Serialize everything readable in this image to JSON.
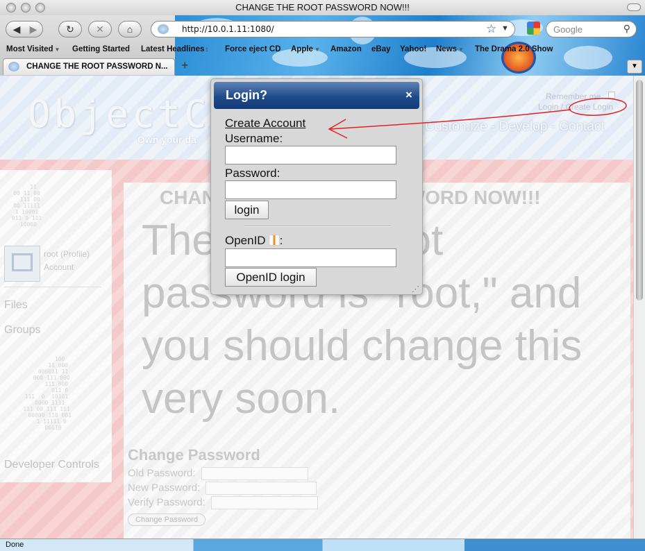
{
  "window": {
    "title": "CHANGE THE ROOT PASSWORD NOW!!!"
  },
  "toolbar": {
    "url": "http://10.0.1.11:1080/",
    "search_placeholder": "Google",
    "back_icon": "back-arrow-icon",
    "forward_icon": "forward-arrow-icon",
    "reload_icon": "reload-icon",
    "stop_icon": "stop-icon",
    "home_icon": "home-icon"
  },
  "bookmarks": [
    {
      "label": "Most Visited",
      "dropdown": true
    },
    {
      "label": "Getting Started",
      "dropdown": false
    },
    {
      "label": "Latest Headlines",
      "dropdown": false
    },
    {
      "label": "Force eject CD",
      "dropdown": false
    },
    {
      "label": "Apple",
      "dropdown": true
    },
    {
      "label": "Amazon",
      "dropdown": false
    },
    {
      "label": "eBay",
      "dropdown": false
    },
    {
      "label": "Yahoo!",
      "dropdown": false
    },
    {
      "label": "News",
      "dropdown": true
    },
    {
      "label": "The Drama 2.0 Show",
      "dropdown": false
    }
  ],
  "tabs": [
    {
      "label": "CHANGE THE ROOT PASSWORD N..."
    }
  ],
  "site": {
    "logo": "ObjectC",
    "tagline": "Own your da",
    "nav": "Customize - Develop - Contact",
    "remember": "Remember me",
    "login_links": "Login / Create Login"
  },
  "sidebar": {
    "profile": "root (Profile)",
    "account": "Account",
    "files": "Files",
    "groups": "Groups",
    "developer": "Developer Controls"
  },
  "main": {
    "title": "CHANGE THE ROOT PASSWORD NOW!!!",
    "body": "The default root password is \"root,\" and you should change this very soon.",
    "change_password": {
      "heading": "Change Password",
      "old": "Old Password:",
      "new": "New Password:",
      "verify": "Verify Password:",
      "button": "Change Password"
    }
  },
  "dialog": {
    "title": "Login?",
    "close": "×",
    "create_account": "Create Account",
    "username_label": "Username:",
    "password_label": "Password:",
    "login_button": "login",
    "openid_label": "OpenID",
    "openid_colon": ":",
    "openid_button": "OpenID login"
  },
  "status": {
    "text": "Done"
  },
  "colors": {
    "dialog_header": "#1f4b8a",
    "annotation": "#e02020",
    "header_band": "#e2ebf6",
    "pink_band": "#f4c9c9"
  }
}
